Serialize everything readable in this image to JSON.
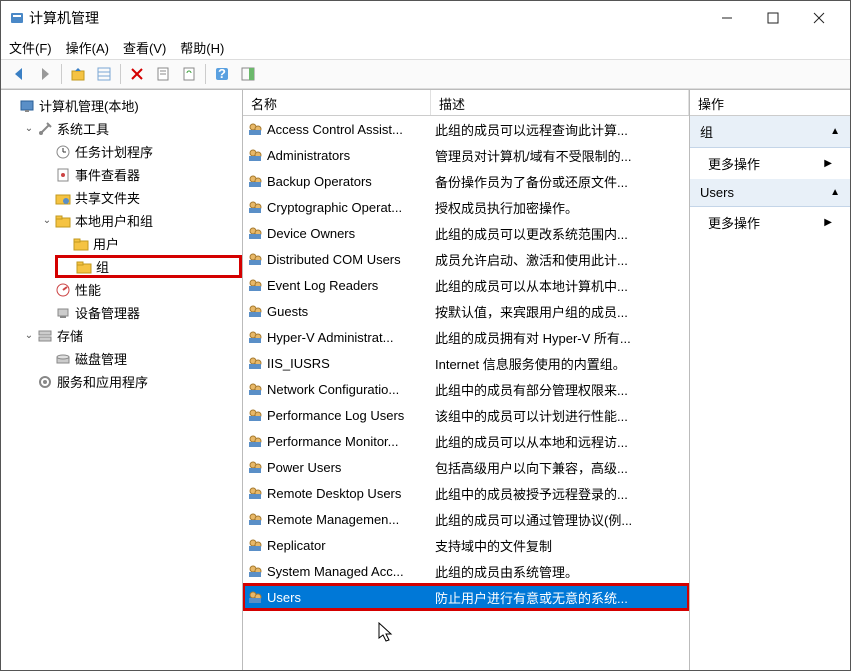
{
  "title": "计算机管理",
  "menus": [
    "文件(F)",
    "操作(A)",
    "查看(V)",
    "帮助(H)"
  ],
  "tree": {
    "root": "计算机管理(本地)",
    "items": [
      {
        "label": "系统工具",
        "open": true,
        "children": [
          {
            "label": "任务计划程序"
          },
          {
            "label": "事件查看器"
          },
          {
            "label": "共享文件夹"
          },
          {
            "label": "本地用户和组",
            "open": true,
            "children": [
              {
                "label": "用户"
              },
              {
                "label": "组",
                "highlight": true
              }
            ]
          },
          {
            "label": "性能"
          },
          {
            "label": "设备管理器"
          }
        ]
      },
      {
        "label": "存储",
        "open": true,
        "children": [
          {
            "label": "磁盘管理"
          }
        ]
      },
      {
        "label": "服务和应用程序"
      }
    ]
  },
  "list": {
    "headers": {
      "name": "名称",
      "desc": "描述"
    },
    "rows": [
      {
        "name": "Access Control Assist...",
        "desc": "此组的成员可以远程查询此计算..."
      },
      {
        "name": "Administrators",
        "desc": "管理员对计算机/域有不受限制的..."
      },
      {
        "name": "Backup Operators",
        "desc": "备份操作员为了备份或还原文件..."
      },
      {
        "name": "Cryptographic Operat...",
        "desc": "授权成员执行加密操作。"
      },
      {
        "name": "Device Owners",
        "desc": "此组的成员可以更改系统范围内..."
      },
      {
        "name": "Distributed COM Users",
        "desc": "成员允许启动、激活和使用此计..."
      },
      {
        "name": "Event Log Readers",
        "desc": "此组的成员可以从本地计算机中..."
      },
      {
        "name": "Guests",
        "desc": "按默认值，来宾跟用户组的成员..."
      },
      {
        "name": "Hyper-V Administrat...",
        "desc": "此组的成员拥有对 Hyper-V 所有..."
      },
      {
        "name": "IIS_IUSRS",
        "desc": "Internet 信息服务使用的内置组。"
      },
      {
        "name": "Network Configuratio...",
        "desc": "此组中的成员有部分管理权限来..."
      },
      {
        "name": "Performance Log Users",
        "desc": "该组中的成员可以计划进行性能..."
      },
      {
        "name": "Performance Monitor...",
        "desc": "此组的成员可以从本地和远程访..."
      },
      {
        "name": "Power Users",
        "desc": "包括高级用户以向下兼容，高级..."
      },
      {
        "name": "Remote Desktop Users",
        "desc": "此组中的成员被授予远程登录的..."
      },
      {
        "name": "Remote Managemen...",
        "desc": "此组的成员可以通过管理协议(例..."
      },
      {
        "name": "Replicator",
        "desc": "支持域中的文件复制"
      },
      {
        "name": "System Managed Acc...",
        "desc": "此组的成员由系统管理。"
      },
      {
        "name": "Users",
        "desc": "防止用户进行有意或无意的系统...",
        "selected": true
      }
    ]
  },
  "actions": {
    "title": "操作",
    "sections": [
      {
        "label": "组",
        "items": [
          "更多操作"
        ]
      },
      {
        "label": "Users",
        "items": [
          "更多操作"
        ]
      }
    ]
  }
}
